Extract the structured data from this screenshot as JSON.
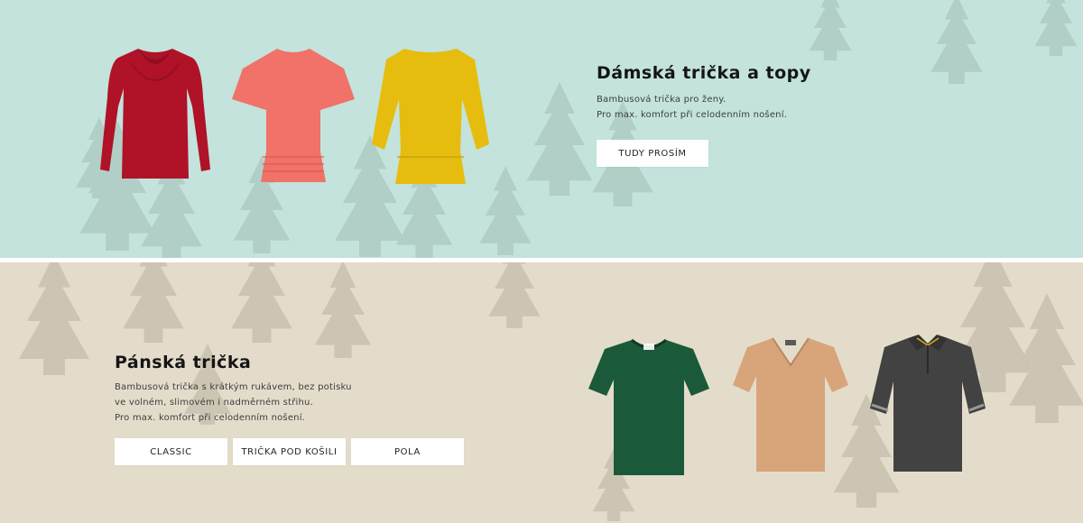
{
  "women": {
    "title": "Dámská trička a topy",
    "description": [
      "Bambusová trička pro ženy.",
      "Pro max. komfort při celodenním nošení."
    ],
    "button": "TUDY PROSÍM",
    "colors": {
      "background": "#c3e3dc",
      "forest": "#8fa8a0"
    },
    "products": [
      {
        "name": "red-cowl-neck-long-sleeve-top",
        "color": "#b01228"
      },
      {
        "name": "coral-batwing-tunic-top",
        "color": "#f07268"
      },
      {
        "name": "yellow-boat-neck-top",
        "color": "#e6bd0e"
      }
    ]
  },
  "men": {
    "title": "Pánská trička",
    "description": [
      "Bambusová trička s krátkým rukávem, bez potisku",
      "ve volném, slimovém i nadměrném střihu.",
      "Pro max. komfort při celodenním nošení."
    ],
    "buttons": [
      "CLASSIC",
      "TRIČKA POD KOŠILI",
      "POLA"
    ],
    "colors": {
      "background": "#e4dccb",
      "forest": "#a39a88"
    },
    "products": [
      {
        "name": "green-crew-neck-tshirt",
        "color": "#1a5a3a"
      },
      {
        "name": "beige-v-neck-tshirt",
        "color": "#d8a47a"
      },
      {
        "name": "grey-polo-shirt",
        "color": "#424242"
      }
    ]
  }
}
